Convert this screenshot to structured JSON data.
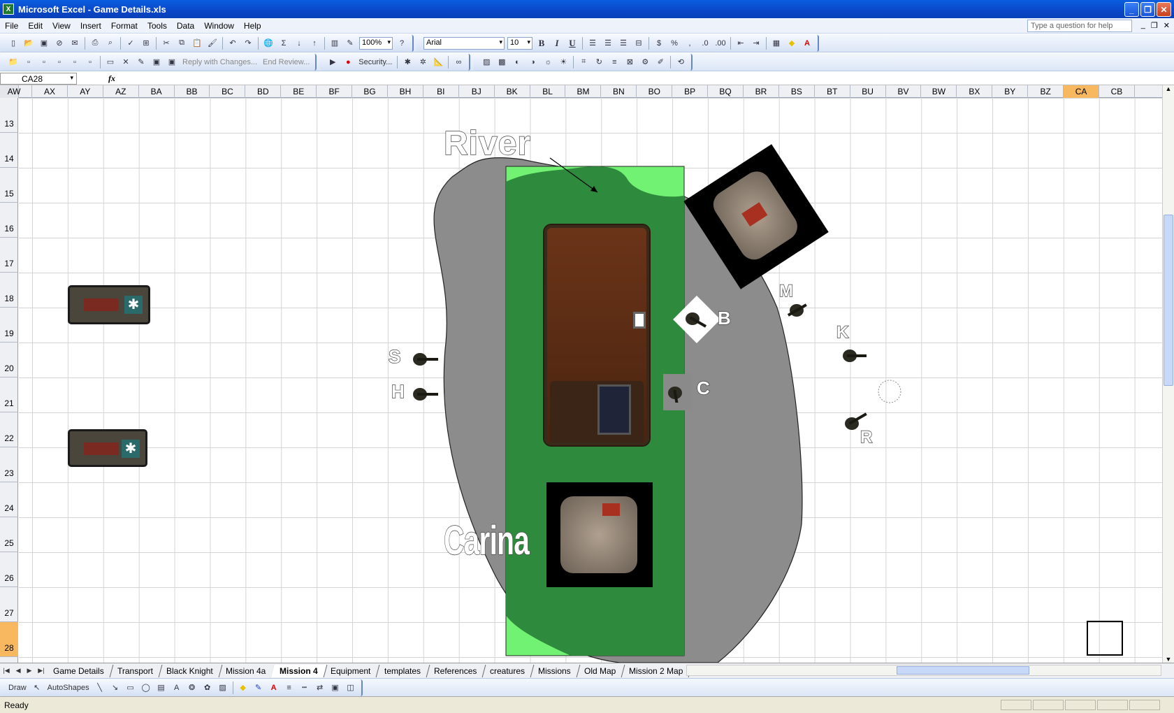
{
  "window": {
    "title": "Microsoft Excel - Game Details.xls",
    "icon": "excel-icon"
  },
  "menu": [
    "File",
    "Edit",
    "View",
    "Insert",
    "Format",
    "Tools",
    "Data",
    "Window",
    "Help"
  ],
  "help_placeholder": "Type a question for help",
  "toolbar": {
    "zoom": "100%",
    "font": "Arial",
    "font_size": "10",
    "bold": "B",
    "italic": "I",
    "underline": "U",
    "percent": "%",
    "comma": ",",
    "reply": "Reply with Changes...",
    "end_review": "End Review...",
    "security": "Security..."
  },
  "formula": {
    "name_box": "CA28",
    "fx": "fx",
    "content": ""
  },
  "columns": [
    "AW",
    "AX",
    "AY",
    "AZ",
    "BA",
    "BB",
    "BC",
    "BD",
    "BE",
    "BF",
    "BG",
    "BH",
    "BI",
    "BJ",
    "BK",
    "BL",
    "BM",
    "BN",
    "BO",
    "BP",
    "BQ",
    "BR",
    "BS",
    "BT",
    "BU",
    "BV",
    "BW",
    "BX",
    "BY",
    "BZ",
    "CA",
    "CB"
  ],
  "selected_column": "CA",
  "rows": [
    "13",
    "14",
    "15",
    "16",
    "17",
    "18",
    "19",
    "20",
    "21",
    "22",
    "23",
    "24",
    "25",
    "26",
    "27",
    "28"
  ],
  "selected_row": "28",
  "map": {
    "river_label": "River",
    "carina_label": "Carina",
    "markers": [
      "S",
      "H",
      "B",
      "C",
      "M",
      "K",
      "R"
    ]
  },
  "sheet_tabs": [
    "Game Details",
    "Transport",
    "Black Knight",
    "Mission 4a",
    "Mission 4",
    "Equipment",
    "templates",
    "References",
    "creatures",
    "Missions",
    "Old Map",
    "Mission 2 Map"
  ],
  "active_tab": "Mission 4",
  "drawbar": {
    "draw": "Draw",
    "autoshapes": "AutoShapes"
  },
  "status": "Ready",
  "colors": {
    "terrain_green": "#2e8a3c",
    "light_green": "#72f272",
    "gray_area": "#8c8c8c",
    "selection": "#f8b860",
    "titlebar": "#0a50d8"
  }
}
